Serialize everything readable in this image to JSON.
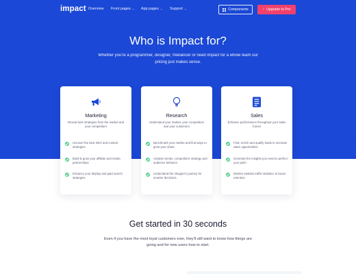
{
  "nav": {
    "logo": "impact",
    "items": [
      {
        "label": "Overview",
        "dropdown": false
      },
      {
        "label": "Front pages",
        "dropdown": true
      },
      {
        "label": "App pages",
        "dropdown": true
      },
      {
        "label": "Support",
        "dropdown": true
      }
    ],
    "components_label": "Components",
    "upgrade_label": "Upgrade to Pro"
  },
  "hero": {
    "title": "Who is Impact for?",
    "subtitle": "Whether you're a programmer, designer, freelancer or need Impact for a whole team our pricing just makes sense."
  },
  "cards": [
    {
      "icon": "megaphone-icon",
      "title": "Marketing",
      "description": "Reveal best strategies from the market and your competitors",
      "features": [
        "Uncover the best SEO and content strategies",
        "Build & grow your affiliate and media partnerships",
        "Enhance your display and paid search strategies"
      ]
    },
    {
      "icon": "lightbulb-icon",
      "title": "Research",
      "description": "Understand your market, your competitors and your customers",
      "features": [
        "Benchmark your market and find ways to grow your share",
        "Analyze trends, competitors' strategy and audience behavior",
        "Understand the shopper's journey for smarter decisions"
      ]
    },
    {
      "icon": "document-icon",
      "title": "Sales",
      "description": "Enhance performance throughout your sales funnel",
      "features": [
        "Find, enrich and qualify leads to increase sales opportunities",
        "Generate the insights you need to perfect your pitch",
        "Monitor website traffic statistics to boost retention"
      ]
    }
  ],
  "getstarted": {
    "title": "Get started in 30 seconds",
    "subtitle": "Even if you have the most loyal customers ever, they'll still want to know how things are going and for new users how to start."
  },
  "colors": {
    "primary": "#1b48d6",
    "danger": "#f1416c",
    "success": "#50cd89"
  }
}
